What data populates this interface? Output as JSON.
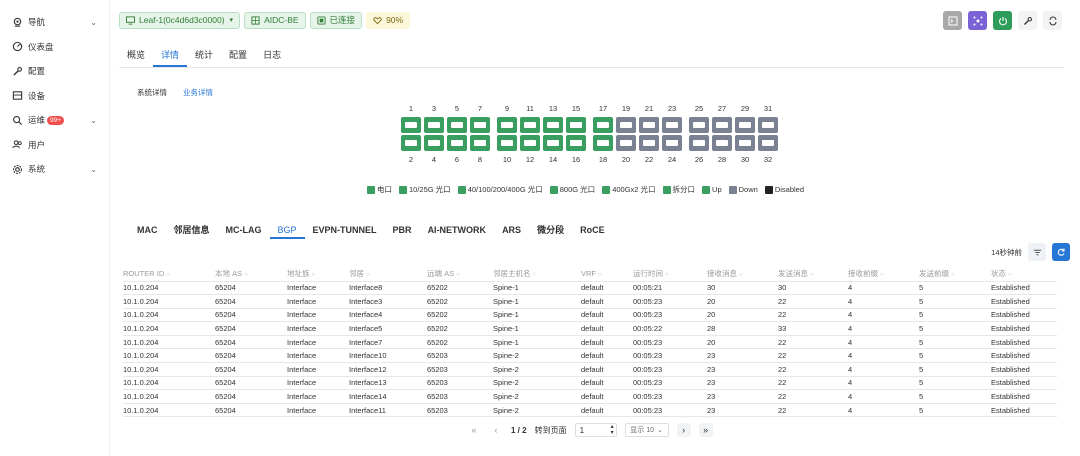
{
  "sidebar": {
    "items": [
      {
        "label": "导航",
        "icon": "location-pin-icon",
        "chevron": "⌄"
      },
      {
        "label": "仪表盘",
        "icon": "dashboard-icon"
      },
      {
        "label": "配置",
        "icon": "wrench-icon"
      },
      {
        "label": "设备",
        "icon": "device-icon"
      },
      {
        "label": "运维",
        "icon": "search-icon",
        "badge": "99+",
        "chevron": "⌄"
      },
      {
        "label": "用户",
        "icon": "users-icon"
      },
      {
        "label": "系统",
        "icon": "gear-icon",
        "chevron": "⌄"
      }
    ]
  },
  "topbar": {
    "device": "Leaf-1(0c4d6d3c0000)",
    "fabric": "AIDC-BE",
    "status": "已连接",
    "health": "90%"
  },
  "tabs": [
    "概览",
    "详情",
    "统计",
    "配置",
    "日志"
  ],
  "active_tab": 1,
  "subtabs": [
    "系统详情",
    "业务详情"
  ],
  "active_subtab": 1,
  "ports": {
    "top_numbers": [
      "1",
      "3",
      "5",
      "7",
      "9",
      "11",
      "13",
      "15",
      "17",
      "19",
      "21",
      "23",
      "25",
      "27",
      "29",
      "31"
    ],
    "bottom_numbers": [
      "2",
      "4",
      "6",
      "8",
      "10",
      "12",
      "14",
      "16",
      "18",
      "20",
      "22",
      "24",
      "26",
      "28",
      "30",
      "32"
    ],
    "status_top": [
      "up",
      "up",
      "up",
      "up",
      "up",
      "up",
      "up",
      "up",
      "up",
      "down",
      "down",
      "down",
      "down",
      "down",
      "down",
      "down"
    ],
    "status_bottom": [
      "up",
      "up",
      "up",
      "up",
      "up",
      "up",
      "up",
      "up",
      "up",
      "down",
      "down",
      "down",
      "down",
      "down",
      "down",
      "down"
    ]
  },
  "legend": [
    {
      "label": "电口",
      "color": "green"
    },
    {
      "label": "10/25G 光口",
      "color": "green"
    },
    {
      "label": "40/100/200/400G 光口",
      "color": "green"
    },
    {
      "label": "800G 光口",
      "color": "green"
    },
    {
      "label": "400Gx2 光口",
      "color": "green"
    },
    {
      "label": "拆分口",
      "color": "green"
    },
    {
      "label": "Up",
      "color": "green"
    },
    {
      "label": "Down",
      "color": "gray"
    },
    {
      "label": "Disabled",
      "color": "black"
    }
  ],
  "protocol_tabs": [
    "MAC",
    "邻居信息",
    "MC-LAG",
    "BGP",
    "EVPN-TUNNEL",
    "PBR",
    "AI-NETWORK",
    "ARS",
    "微分段",
    "RoCE"
  ],
  "active_protocol_tab": 3,
  "refresh_ago": "14秒钟前",
  "table": {
    "headers": [
      "ROUTER ID",
      "本地 AS",
      "地址族",
      "邻居",
      "远端 AS",
      "邻居主机名",
      "VRF",
      "运行时间",
      "接收消息",
      "发送消息",
      "接收前缀",
      "发送前缀",
      "状态"
    ],
    "rows": [
      [
        "10.1.0.204",
        "65204",
        "Interface",
        "Interface8",
        "65202",
        "Spine-1",
        "default",
        "00:05:21",
        "30",
        "30",
        "4",
        "5",
        "Established"
      ],
      [
        "10.1.0.204",
        "65204",
        "Interface",
        "Interface3",
        "65202",
        "Spine-1",
        "default",
        "00:05:23",
        "20",
        "22",
        "4",
        "5",
        "Established"
      ],
      [
        "10.1.0.204",
        "65204",
        "Interface",
        "Interface4",
        "65202",
        "Spine-1",
        "default",
        "00:05:23",
        "20",
        "22",
        "4",
        "5",
        "Established"
      ],
      [
        "10.1.0.204",
        "65204",
        "Interface",
        "Interface5",
        "65202",
        "Spine-1",
        "default",
        "00:05:22",
        "28",
        "33",
        "4",
        "5",
        "Established"
      ],
      [
        "10.1.0.204",
        "65204",
        "Interface",
        "Interface7",
        "65202",
        "Spine-1",
        "default",
        "00:05:23",
        "20",
        "22",
        "4",
        "5",
        "Established"
      ],
      [
        "10.1.0.204",
        "65204",
        "Interface",
        "Interface10",
        "65203",
        "Spine-2",
        "default",
        "00:05:23",
        "23",
        "22",
        "4",
        "5",
        "Established"
      ],
      [
        "10.1.0.204",
        "65204",
        "Interface",
        "Interface12",
        "65203",
        "Spine-2",
        "default",
        "00:05:23",
        "23",
        "22",
        "4",
        "5",
        "Established"
      ],
      [
        "10.1.0.204",
        "65204",
        "Interface",
        "Interface13",
        "65203",
        "Spine-2",
        "default",
        "00:05:23",
        "23",
        "22",
        "4",
        "5",
        "Established"
      ],
      [
        "10.1.0.204",
        "65204",
        "Interface",
        "Interface14",
        "65203",
        "Spine-2",
        "default",
        "00:05:23",
        "23",
        "22",
        "4",
        "5",
        "Established"
      ],
      [
        "10.1.0.204",
        "65204",
        "Interface",
        "Interface11",
        "65203",
        "Spine-2",
        "default",
        "00:05:23",
        "23",
        "22",
        "4",
        "5",
        "Established"
      ]
    ]
  },
  "pager": {
    "page_info": "1 / 2",
    "goto_label": "转到页面",
    "goto_value": "1",
    "page_size": "显示 10"
  }
}
